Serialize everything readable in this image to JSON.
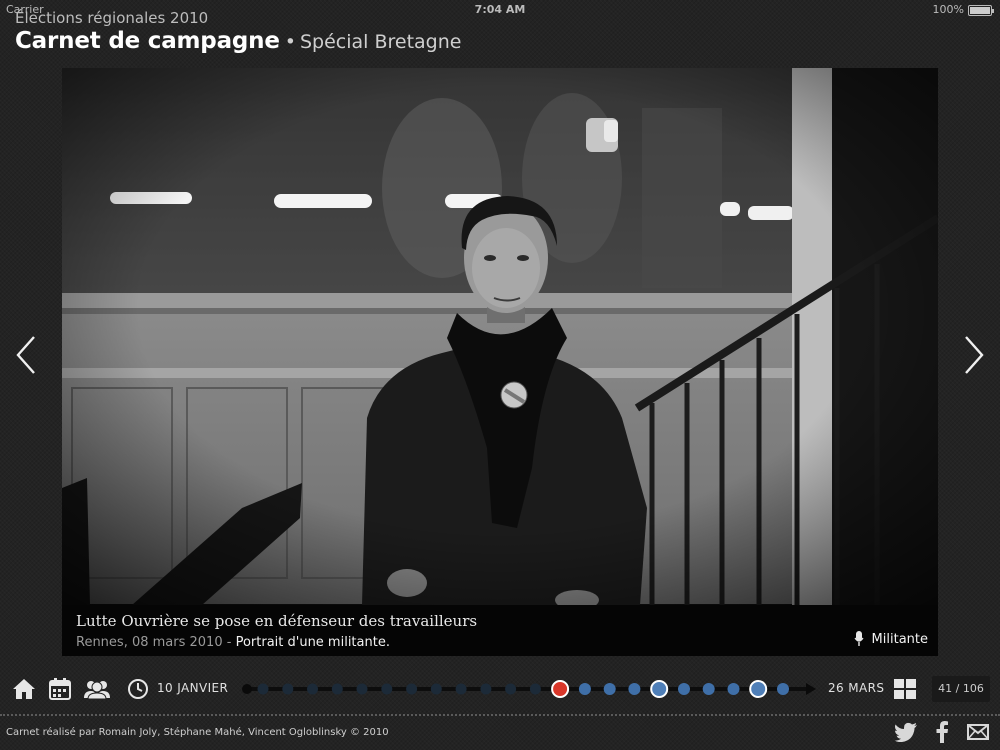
{
  "status_bar": {
    "carrier": "Carrier",
    "time": "7:04 AM",
    "battery": "100%"
  },
  "header": {
    "supertitle": "Élections régionales 2010",
    "title": "Carnet de campagne",
    "separator": "•",
    "subtitle": "Spécial Bretagne"
  },
  "photo": {
    "caption_title": "Lutte Ouvrière se pose en défenseur des travailleurs",
    "place_date": "Rennes, 08 mars 2010",
    "meta_separator": " - ",
    "description": "Portrait d'une militante.",
    "tag": "Militante",
    "tag_icon": "microphone-icon"
  },
  "nav": {
    "prev_icon": "chevron-left-icon",
    "next_icon": "chevron-right-icon",
    "home_icon": "home-icon",
    "calendar_icon": "calendar-icon",
    "people_icon": "people-icon",
    "clock_icon": "clock-icon",
    "grid_icon": "grid-icon",
    "start_date": "10 JANVIER",
    "end_date": "26 MARS",
    "counter": "41 / 106"
  },
  "timeline": {
    "dots": [
      {
        "state": "dark"
      },
      {
        "state": "dark"
      },
      {
        "state": "dark"
      },
      {
        "state": "dark"
      },
      {
        "state": "dark"
      },
      {
        "state": "dark"
      },
      {
        "state": "dark"
      },
      {
        "state": "dark"
      },
      {
        "state": "dark"
      },
      {
        "state": "dark"
      },
      {
        "state": "dark"
      },
      {
        "state": "dark"
      },
      {
        "state": "current"
      },
      {
        "state": "light"
      },
      {
        "state": "light"
      },
      {
        "state": "light"
      },
      {
        "state": "large"
      },
      {
        "state": "light"
      },
      {
        "state": "light"
      },
      {
        "state": "light"
      },
      {
        "state": "large"
      },
      {
        "state": "light"
      }
    ],
    "colors": {
      "dark": "#1c2a38",
      "light": "#3f6fa8",
      "current": "#d9372a",
      "large": "#4f7fb8",
      "line": "#0d0d0d"
    }
  },
  "footer": {
    "credit": "Carnet réalisé par Romain Joly, Stéphane Mahé, Vincent Ogloblinsky © 2010",
    "share_icons": [
      "twitter-icon",
      "facebook-icon",
      "mail-icon"
    ]
  }
}
